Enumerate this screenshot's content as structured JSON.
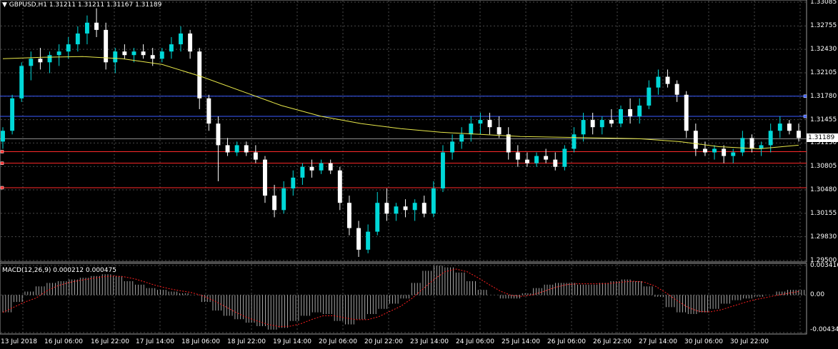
{
  "header": {
    "symbol_tf": "GBPUSD,H1",
    "ohlc": "1.31211 1.31211 1.31167 1.31189",
    "macd_label": "MACD(12,26,9) 0.000212 0.000475"
  },
  "current_price": "1.31189",
  "price_axis": {
    "labels": [
      "1.33085",
      "1.32755",
      "1.32430",
      "1.32105",
      "1.31780",
      "1.31455",
      "1.31130",
      "1.30805",
      "1.30480",
      "1.30155",
      "1.29830",
      "1.29500"
    ]
  },
  "macd_axis": {
    "labels": [
      "0.003416",
      "0.00",
      "-0.004345"
    ]
  },
  "time_axis": {
    "labels": [
      "13 Jul 2018",
      "16 Jul 06:00",
      "16 Jul 22:00",
      "17 Jul 14:00",
      "18 Jul 06:00",
      "18 Jul 22:00",
      "19 Jul 14:00",
      "20 Jul 06:00",
      "20 Jul 22:00",
      "23 Jul 14:00",
      "24 Jul 06:00",
      "25 Jul 14:00",
      "26 Jul 06:00",
      "26 Jul 22:00",
      "27 Jul 14:00",
      "30 Jul 06:00",
      "30 Jul 22:00"
    ]
  },
  "levels": {
    "blue": [
      "1.31780",
      "1.31500"
    ],
    "red": [
      "1.31010",
      "1.30850",
      "1.30510"
    ],
    "ask": "1.31189"
  },
  "colors": {
    "background": "#000000",
    "grid": "#4a4a4a",
    "bull": "#00d8d8",
    "bear": "#ffffff",
    "ma": "#e8e84a",
    "level_blue": "#3a5aff",
    "level_red": "#ff2a2a",
    "macd_signal": "#ff2020"
  },
  "chart_data": {
    "type": "candlestick",
    "ohlc_series": [
      {
        "o": 1.3115,
        "h": 1.3135,
        "l": 1.3105,
        "c": 1.313
      },
      {
        "o": 1.313,
        "h": 1.318,
        "l": 1.3125,
        "c": 1.3175
      },
      {
        "o": 1.3175,
        "h": 1.3225,
        "l": 1.317,
        "c": 1.322
      },
      {
        "o": 1.322,
        "h": 1.324,
        "l": 1.32,
        "c": 1.323
      },
      {
        "o": 1.323,
        "h": 1.3245,
        "l": 1.3215,
        "c": 1.3225
      },
      {
        "o": 1.3225,
        "h": 1.324,
        "l": 1.321,
        "c": 1.3235
      },
      {
        "o": 1.3235,
        "h": 1.325,
        "l": 1.322,
        "c": 1.324
      },
      {
        "o": 1.324,
        "h": 1.326,
        "l": 1.323,
        "c": 1.325
      },
      {
        "o": 1.325,
        "h": 1.3275,
        "l": 1.324,
        "c": 1.3265
      },
      {
        "o": 1.3265,
        "h": 1.329,
        "l": 1.325,
        "c": 1.328
      },
      {
        "o": 1.328,
        "h": 1.33,
        "l": 1.326,
        "c": 1.327
      },
      {
        "o": 1.327,
        "h": 1.328,
        "l": 1.3215,
        "c": 1.3225
      },
      {
        "o": 1.3225,
        "h": 1.3245,
        "l": 1.321,
        "c": 1.324
      },
      {
        "o": 1.324,
        "h": 1.325,
        "l": 1.323,
        "c": 1.3235
      },
      {
        "o": 1.3235,
        "h": 1.3245,
        "l": 1.3225,
        "c": 1.324
      },
      {
        "o": 1.324,
        "h": 1.325,
        "l": 1.323,
        "c": 1.3235
      },
      {
        "o": 1.3235,
        "h": 1.3245,
        "l": 1.322,
        "c": 1.323
      },
      {
        "o": 1.323,
        "h": 1.3245,
        "l": 1.3225,
        "c": 1.324
      },
      {
        "o": 1.324,
        "h": 1.326,
        "l": 1.323,
        "c": 1.325
      },
      {
        "o": 1.325,
        "h": 1.3275,
        "l": 1.324,
        "c": 1.3265
      },
      {
        "o": 1.3265,
        "h": 1.327,
        "l": 1.323,
        "c": 1.324
      },
      {
        "o": 1.324,
        "h": 1.3245,
        "l": 1.316,
        "c": 1.3175
      },
      {
        "o": 1.3175,
        "h": 1.318,
        "l": 1.313,
        "c": 1.314
      },
      {
        "o": 1.314,
        "h": 1.315,
        "l": 1.306,
        "c": 1.311
      },
      {
        "o": 1.311,
        "h": 1.312,
        "l": 1.3095,
        "c": 1.31
      },
      {
        "o": 1.31,
        "h": 1.3115,
        "l": 1.3095,
        "c": 1.311
      },
      {
        "o": 1.311,
        "h": 1.3115,
        "l": 1.3095,
        "c": 1.31
      },
      {
        "o": 1.31,
        "h": 1.311,
        "l": 1.3085,
        "c": 1.309
      },
      {
        "o": 1.309,
        "h": 1.3095,
        "l": 1.303,
        "c": 1.304
      },
      {
        "o": 1.304,
        "h": 1.3055,
        "l": 1.301,
        "c": 1.302
      },
      {
        "o": 1.302,
        "h": 1.306,
        "l": 1.3015,
        "c": 1.305
      },
      {
        "o": 1.305,
        "h": 1.3075,
        "l": 1.304,
        "c": 1.3065
      },
      {
        "o": 1.3065,
        "h": 1.3085,
        "l": 1.3055,
        "c": 1.308
      },
      {
        "o": 1.308,
        "h": 1.309,
        "l": 1.3065,
        "c": 1.3075
      },
      {
        "o": 1.3075,
        "h": 1.309,
        "l": 1.307,
        "c": 1.3085
      },
      {
        "o": 1.3085,
        "h": 1.309,
        "l": 1.307,
        "c": 1.3075
      },
      {
        "o": 1.3075,
        "h": 1.308,
        "l": 1.302,
        "c": 1.303
      },
      {
        "o": 1.303,
        "h": 1.304,
        "l": 1.2985,
        "c": 1.2995
      },
      {
        "o": 1.2995,
        "h": 1.3005,
        "l": 1.2955,
        "c": 1.2965
      },
      {
        "o": 1.2965,
        "h": 1.3,
        "l": 1.296,
        "c": 1.299
      },
      {
        "o": 1.299,
        "h": 1.3045,
        "l": 1.2985,
        "c": 1.303
      },
      {
        "o": 1.303,
        "h": 1.305,
        "l": 1.3005,
        "c": 1.3015
      },
      {
        "o": 1.3015,
        "h": 1.303,
        "l": 1.3005,
        "c": 1.3025
      },
      {
        "o": 1.3025,
        "h": 1.3035,
        "l": 1.301,
        "c": 1.302
      },
      {
        "o": 1.302,
        "h": 1.3035,
        "l": 1.3005,
        "c": 1.303
      },
      {
        "o": 1.303,
        "h": 1.304,
        "l": 1.301,
        "c": 1.3015
      },
      {
        "o": 1.3015,
        "h": 1.306,
        "l": 1.301,
        "c": 1.305
      },
      {
        "o": 1.305,
        "h": 1.311,
        "l": 1.3045,
        "c": 1.31
      },
      {
        "o": 1.31,
        "h": 1.3125,
        "l": 1.309,
        "c": 1.3115
      },
      {
        "o": 1.3115,
        "h": 1.3135,
        "l": 1.3105,
        "c": 1.3125
      },
      {
        "o": 1.3125,
        "h": 1.315,
        "l": 1.3115,
        "c": 1.314
      },
      {
        "o": 1.314,
        "h": 1.3155,
        "l": 1.3125,
        "c": 1.3145
      },
      {
        "o": 1.3145,
        "h": 1.3155,
        "l": 1.3125,
        "c": 1.3135
      },
      {
        "o": 1.3135,
        "h": 1.315,
        "l": 1.312,
        "c": 1.3125
      },
      {
        "o": 1.3125,
        "h": 1.3135,
        "l": 1.309,
        "c": 1.31
      },
      {
        "o": 1.31,
        "h": 1.311,
        "l": 1.308,
        "c": 1.309
      },
      {
        "o": 1.309,
        "h": 1.31,
        "l": 1.308,
        "c": 1.3085
      },
      {
        "o": 1.3085,
        "h": 1.31,
        "l": 1.308,
        "c": 1.3095
      },
      {
        "o": 1.3095,
        "h": 1.3105,
        "l": 1.3085,
        "c": 1.309
      },
      {
        "o": 1.309,
        "h": 1.31,
        "l": 1.3075,
        "c": 1.308
      },
      {
        "o": 1.308,
        "h": 1.311,
        "l": 1.3075,
        "c": 1.3105
      },
      {
        "o": 1.3105,
        "h": 1.3135,
        "l": 1.31,
        "c": 1.3125
      },
      {
        "o": 1.3125,
        "h": 1.3155,
        "l": 1.3115,
        "c": 1.3145
      },
      {
        "o": 1.3145,
        "h": 1.3155,
        "l": 1.3125,
        "c": 1.3135
      },
      {
        "o": 1.3135,
        "h": 1.315,
        "l": 1.3125,
        "c": 1.3145
      },
      {
        "o": 1.3145,
        "h": 1.316,
        "l": 1.3135,
        "c": 1.314
      },
      {
        "o": 1.314,
        "h": 1.3165,
        "l": 1.3135,
        "c": 1.316
      },
      {
        "o": 1.316,
        "h": 1.3175,
        "l": 1.314,
        "c": 1.315
      },
      {
        "o": 1.315,
        "h": 1.3175,
        "l": 1.314,
        "c": 1.3165
      },
      {
        "o": 1.3165,
        "h": 1.32,
        "l": 1.316,
        "c": 1.319
      },
      {
        "o": 1.319,
        "h": 1.3215,
        "l": 1.318,
        "c": 1.3205
      },
      {
        "o": 1.3205,
        "h": 1.3215,
        "l": 1.319,
        "c": 1.3195
      },
      {
        "o": 1.3195,
        "h": 1.32,
        "l": 1.317,
        "c": 1.318
      },
      {
        "o": 1.318,
        "h": 1.3185,
        "l": 1.312,
        "c": 1.313
      },
      {
        "o": 1.313,
        "h": 1.314,
        "l": 1.3095,
        "c": 1.3105
      },
      {
        "o": 1.3105,
        "h": 1.3115,
        "l": 1.3095,
        "c": 1.31
      },
      {
        "o": 1.31,
        "h": 1.311,
        "l": 1.309,
        "c": 1.3105
      },
      {
        "o": 1.3105,
        "h": 1.311,
        "l": 1.3085,
        "c": 1.3095
      },
      {
        "o": 1.3095,
        "h": 1.3105,
        "l": 1.3085,
        "c": 1.31
      },
      {
        "o": 1.31,
        "h": 1.313,
        "l": 1.3095,
        "c": 1.312
      },
      {
        "o": 1.312,
        "h": 1.3125,
        "l": 1.31,
        "c": 1.3105
      },
      {
        "o": 1.3105,
        "h": 1.3115,
        "l": 1.3095,
        "c": 1.311
      },
      {
        "o": 1.311,
        "h": 1.314,
        "l": 1.31,
        "c": 1.313
      },
      {
        "o": 1.313,
        "h": 1.315,
        "l": 1.312,
        "c": 1.314
      },
      {
        "o": 1.314,
        "h": 1.3145,
        "l": 1.3125,
        "c": 1.313
      },
      {
        "o": 1.313,
        "h": 1.314,
        "l": 1.3115,
        "c": 1.312
      }
    ],
    "moving_average": [
      1.323,
      1.3232,
      1.3233,
      1.323,
      1.3222,
      1.3205,
      1.3185,
      1.3165,
      1.315,
      1.314,
      1.3133,
      1.3128,
      1.3125,
      1.3122,
      1.3121,
      1.312,
      1.3119,
      1.3115,
      1.3108,
      1.3105,
      1.311
    ],
    "y_range": [
      1.295,
      1.33085
    ],
    "macd": {
      "histogram": [
        -0.002,
        -0.0008,
        0.0004,
        0.001,
        0.0014,
        0.0016,
        0.0018,
        0.002,
        0.0022,
        0.0024,
        0.0022,
        0.0016,
        0.0012,
        0.0008,
        0.0006,
        0.0004,
        0.0002,
        0.0,
        -0.0008,
        -0.0018,
        -0.0024,
        -0.0028,
        -0.0032,
        -0.0036,
        -0.004,
        -0.0038,
        -0.003,
        -0.0024,
        -0.002,
        -0.0022,
        -0.003,
        -0.0034,
        -0.0028,
        -0.0022,
        -0.0016,
        -0.001,
        -0.0004,
        0.0014,
        0.0028,
        0.0034,
        0.0032,
        0.0026,
        0.0016,
        0.0006,
        0.0,
        -0.0004,
        -0.0004,
        0.0002,
        0.0008,
        0.0012,
        0.0014,
        0.0014,
        0.0012,
        0.0012,
        0.0014,
        0.0016,
        0.0018,
        0.0016,
        0.001,
        -0.0002,
        -0.0014,
        -0.002,
        -0.0022,
        -0.002,
        -0.0016,
        -0.001,
        -0.0006,
        -0.0004,
        -0.0002,
        0.0,
        0.0004,
        0.0006,
        0.0006
      ],
      "range": [
        -0.004345,
        0.003416
      ]
    }
  }
}
